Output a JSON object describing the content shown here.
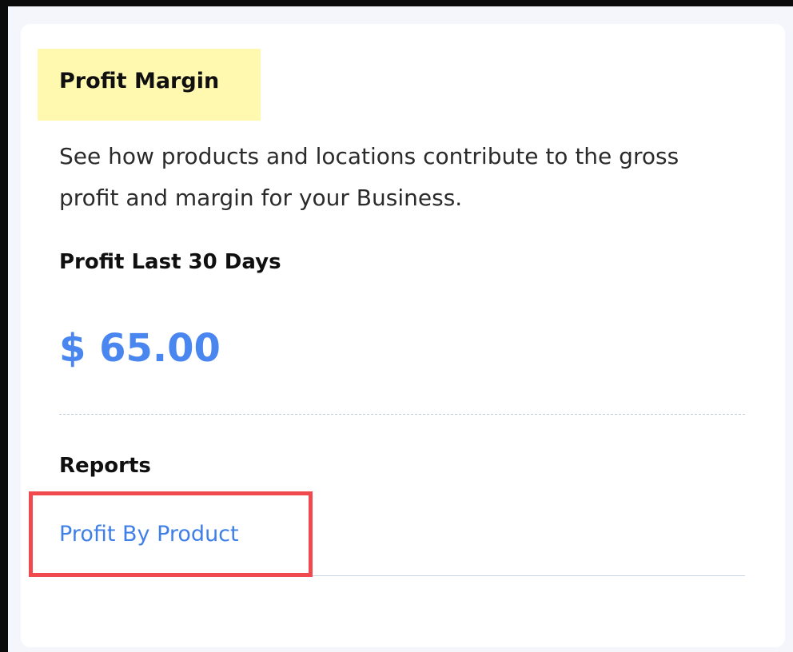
{
  "card": {
    "title": "Profit Margin",
    "description": "See how products and locations contribute to the gross profit and margin for your Business.",
    "profit_label": "Profit Last 30 Days",
    "profit_amount": "$ 65.00",
    "reports_label": "Reports",
    "reports": [
      {
        "label": "Profit By Product"
      }
    ]
  },
  "colors": {
    "title_highlight": "#fff9b0",
    "amount": "#4a86ef",
    "link": "#3f7fe8",
    "annotation_box": "#f04a4e"
  }
}
